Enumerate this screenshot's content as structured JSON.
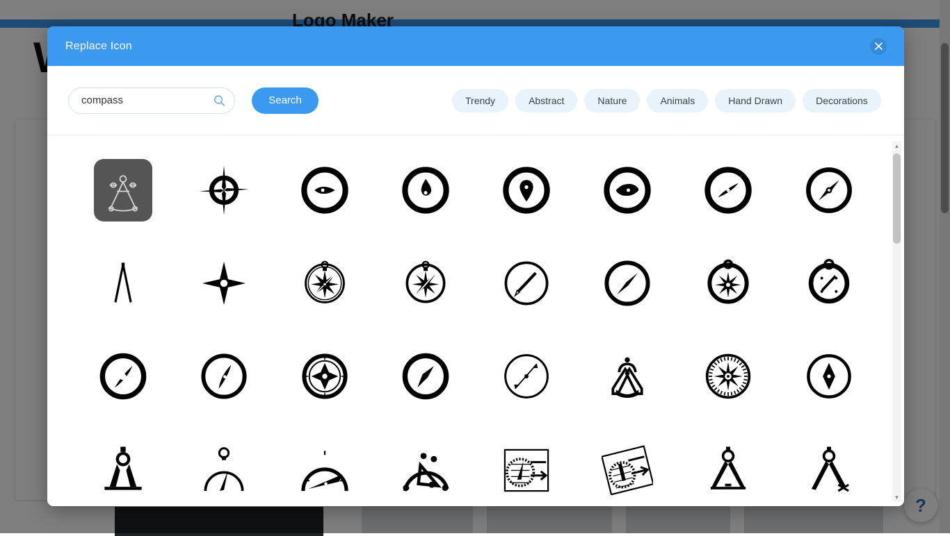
{
  "background": {
    "wordmark": "W",
    "headline": "Logo Maker",
    "help_label": "?",
    "topbar_color": "#3b99ef"
  },
  "modal": {
    "title": "Replace Icon",
    "close_icon": "close-icon",
    "accent_color": "#3b99ef"
  },
  "search": {
    "value": "compass",
    "placeholder": "Search icons",
    "icon": "search-icon",
    "button_label": "Search"
  },
  "categories": [
    {
      "label": "Trendy"
    },
    {
      "label": "Abstract"
    },
    {
      "label": "Nature"
    },
    {
      "label": "Animals"
    },
    {
      "label": "Hand Drawn"
    },
    {
      "label": "Decorations"
    }
  ],
  "results": {
    "selected_index": 0,
    "icons": [
      {
        "name": "drafting-compass-outline-icon",
        "selected": true
      },
      {
        "name": "compass-crosshair-star-icon",
        "selected": false
      },
      {
        "name": "compass-ring-leaf-needle-icon",
        "selected": false
      },
      {
        "name": "compass-ring-droplet-needle-icon",
        "selected": false
      },
      {
        "name": "compass-ring-pin-needle-icon",
        "selected": false
      },
      {
        "name": "compass-ring-eye-needle-icon",
        "selected": false
      },
      {
        "name": "compass-ring-safari-needle-icon",
        "selected": false
      },
      {
        "name": "compass-ring-double-needle-icon",
        "selected": false
      },
      {
        "name": "divider-compass-icon",
        "selected": false
      },
      {
        "name": "four-point-star-icon",
        "selected": false
      },
      {
        "name": "pocket-compass-rose-icon",
        "selected": false
      },
      {
        "name": "pocket-compass-star-icon",
        "selected": false
      },
      {
        "name": "compass-thin-ring-needle-icon",
        "selected": false
      },
      {
        "name": "compass-ring-arrow-needle-icon",
        "selected": false
      },
      {
        "name": "pocket-compass-eight-point-icon",
        "selected": false
      },
      {
        "name": "pocket-compass-dots-icon",
        "selected": false
      },
      {
        "name": "compass-ring-lens-needle-icon",
        "selected": false
      },
      {
        "name": "compass-ring-slim-needle-icon",
        "selected": false
      },
      {
        "name": "compass-double-ring-star-icon",
        "selected": false
      },
      {
        "name": "compass-ring-kite-needle-icon",
        "selected": false
      },
      {
        "name": "compass-thin-line-needle-icon",
        "selected": false
      },
      {
        "name": "drafting-compass-arc-icon",
        "selected": false
      },
      {
        "name": "compass-rose-ticks-icon",
        "selected": false
      },
      {
        "name": "compass-ring-diamond-needle-icon",
        "selected": false
      },
      {
        "name": "compass-divider-stand-icon",
        "selected": false
      },
      {
        "name": "pocket-compass-half-icon",
        "selected": false
      },
      {
        "name": "compass-gauge-dial-icon",
        "selected": false
      },
      {
        "name": "compass-curve-tool-icon",
        "selected": false
      },
      {
        "name": "compass-dial-arrow-card-icon",
        "selected": false
      },
      {
        "name": "compass-dial-arrow-tilted-icon",
        "selected": false
      },
      {
        "name": "divider-compass-triangle-icon",
        "selected": false
      },
      {
        "name": "divider-compass-open-icon",
        "selected": false
      }
    ]
  },
  "scrollbar": {
    "up_arrow": "▲",
    "down_arrow": "▼"
  }
}
